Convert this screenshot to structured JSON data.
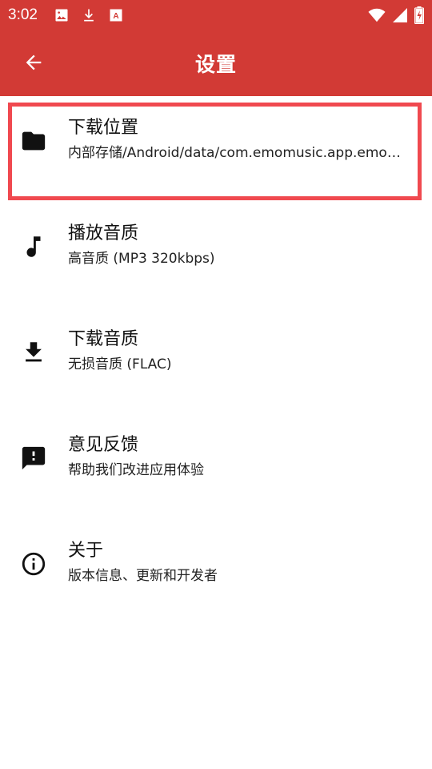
{
  "status_bar": {
    "time": "3:02",
    "left_icons": [
      "image-icon",
      "download-icon",
      "font-icon"
    ],
    "right_icons": [
      "wifi-icon",
      "signal-icon",
      "battery-charging-icon"
    ]
  },
  "app_bar": {
    "title": "设置",
    "back_icon": "arrow-back-icon",
    "color": "#d23a35"
  },
  "settings": [
    {
      "icon": "folder-icon",
      "title": "下载位置",
      "subtitle": "内部存储/Android/data/com.emomusic.app.emomusic/files/Music"
    },
    {
      "icon": "music-note-icon",
      "title": "播放音质",
      "subtitle": "高音质 (MP3 320kbps)"
    },
    {
      "icon": "download-icon",
      "title": "下载音质",
      "subtitle": "无损音质 (FLAC)"
    },
    {
      "icon": "feedback-icon",
      "title": "意见反馈",
      "subtitle": "帮助我们改进应用体验"
    },
    {
      "icon": "info-icon",
      "title": "关于",
      "subtitle": "版本信息、更新和开发者"
    }
  ],
  "highlight_color": "#f0494f"
}
